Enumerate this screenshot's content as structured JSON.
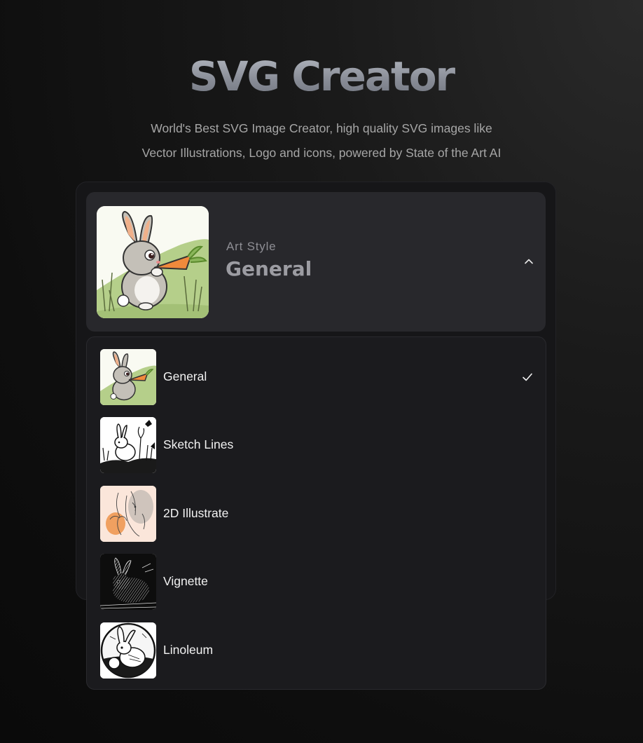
{
  "app": {
    "title": "SVG Creator",
    "subtitle_line1": "World's Best SVG Image Creator, high quality SVG images like",
    "subtitle_line2": "Vector Illustrations, Logo and icons, powered by State of the Art AI"
  },
  "art_style": {
    "label": "Art Style",
    "selected": "General",
    "thumbnail_icon": "rabbit-carrot-illustration",
    "toggle_icon": "chevron-up-icon"
  },
  "dropdown": {
    "options": [
      {
        "label": "General",
        "icon": "rabbit-general-thumb",
        "selected": true
      },
      {
        "label": "Sketch Lines",
        "icon": "rabbit-sketch-thumb",
        "selected": false
      },
      {
        "label": "2D Illustrate",
        "icon": "rabbit-2d-thumb",
        "selected": false
      },
      {
        "label": "Vignette",
        "icon": "rabbit-vignette-thumb",
        "selected": false
      },
      {
        "label": "Linoleum",
        "icon": "rabbit-linoleum-thumb",
        "selected": false
      }
    ],
    "check_icon": "checkmark-icon"
  },
  "colors": {
    "background": "#0e0e0e",
    "card": "#161618",
    "header": "#28282c",
    "dropdown": "#1b1b1e",
    "grass": "#a8c47e",
    "carrot": "#f08a3c"
  }
}
